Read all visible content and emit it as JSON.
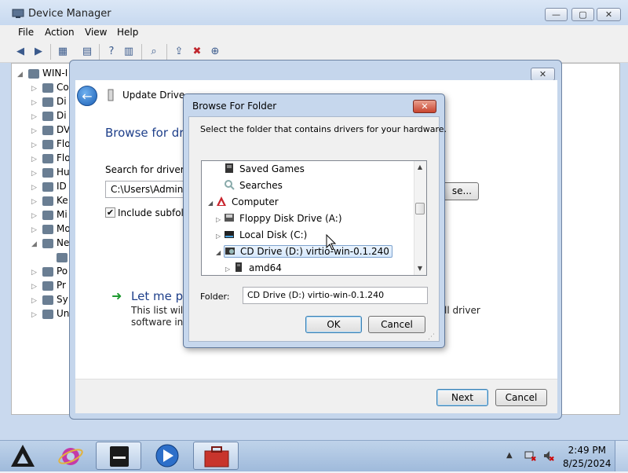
{
  "device_manager": {
    "title": "Device Manager",
    "menu": [
      "File",
      "Action",
      "View",
      "Help"
    ],
    "caption_buttons": {
      "minimize": "—",
      "maximize": "▢",
      "close": "✕"
    },
    "tree_root": "WIN-I",
    "tree_items": [
      "Co",
      "Di",
      "Di",
      "DV",
      "Flo",
      "Flo",
      "Hu",
      "ID",
      "Ke",
      "Mi",
      "Mo",
      "Ne",
      "",
      "Po",
      "Pr",
      "Sy",
      "Un"
    ]
  },
  "wizard": {
    "title": "Update Driver So",
    "heading": "Browse for dri",
    "search_label": "Search for driver so",
    "path_value": "C:\\Users\\Adminis",
    "browse_button": "se...",
    "include_subfolders": "Include subfold",
    "include_checked": true,
    "letme": "Let me pi",
    "list_left_1": "This list will s",
    "list_left_2": "software in th",
    "list_right": "ll driver",
    "next_button": "Next",
    "cancel_button": "Cancel",
    "close_glyph": "✕"
  },
  "browse_dialog": {
    "title": "Browse For Folder",
    "close_glyph": "✕",
    "instruction": "Select the folder that contains drivers for your hardware.",
    "tree": [
      {
        "label": "Saved Games",
        "level": 1,
        "expander": "",
        "icon": "saved-games-icon"
      },
      {
        "label": "Searches",
        "level": 1,
        "expander": "",
        "icon": "searches-icon"
      },
      {
        "label": "Computer",
        "level": 0,
        "expander": "◢",
        "icon": "computer-icon"
      },
      {
        "label": "Floppy Disk Drive (A:)",
        "level": 1,
        "expander": "▷",
        "icon": "floppy-drive-icon"
      },
      {
        "label": "Local Disk (C:)",
        "level": 1,
        "expander": "▷",
        "icon": "local-disk-icon"
      },
      {
        "label": "CD Drive (D:) virtio-win-0.1.240",
        "level": 1,
        "expander": "◢",
        "icon": "cd-drive-icon",
        "selected": true
      },
      {
        "label": "amd64",
        "level": 2,
        "expander": "▷",
        "icon": "folder-icon"
      }
    ],
    "folder_label": "Folder:",
    "folder_value": "CD Drive (D:) virtio-win-0.1.240",
    "ok_button": "OK",
    "cancel_button": "Cancel"
  },
  "taskbar": {
    "time": "2:49 PM",
    "date": "8/25/2024",
    "items": [
      "start-logo",
      "internet-explorer",
      "terminal",
      "media-player",
      "toolbox"
    ]
  },
  "colors": {
    "accent_blue": "#1e3f8a",
    "selection": "#d6e8fc",
    "close_red": "#c9452f"
  }
}
